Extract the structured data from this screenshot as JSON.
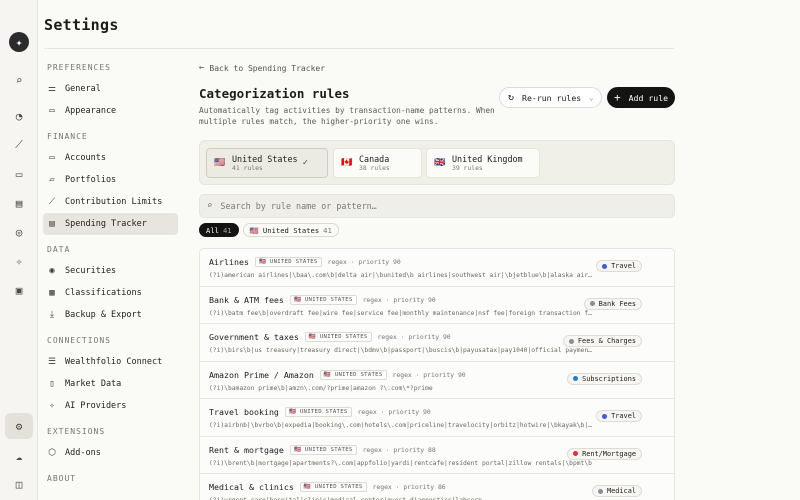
{
  "page": {
    "title": "Settings"
  },
  "rail": {
    "icons": [
      "logo-icon",
      "search-icon",
      "dashboard-icon",
      "chart-icon",
      "holdings-icon",
      "activity-icon",
      "target-icon",
      "sparkle-icon",
      "briefcase-icon",
      "settings-icon",
      "cloud-icon",
      "sidebar-toggle-icon"
    ]
  },
  "sidebar": {
    "preferences": {
      "heading": "PREFERENCES",
      "items": [
        {
          "label": "General"
        },
        {
          "label": "Appearance"
        }
      ]
    },
    "finance": {
      "heading": "FINANCE",
      "items": [
        {
          "label": "Accounts"
        },
        {
          "label": "Portfolios"
        },
        {
          "label": "Contribution Limits"
        },
        {
          "label": "Spending Tracker"
        }
      ]
    },
    "data": {
      "heading": "DATA",
      "items": [
        {
          "label": "Securities"
        },
        {
          "label": "Classifications"
        },
        {
          "label": "Backup & Export"
        }
      ]
    },
    "connections": {
      "heading": "CONNECTIONS",
      "items": [
        {
          "label": "Wealthfolio Connect"
        },
        {
          "label": "Market Data"
        },
        {
          "label": "AI Providers"
        }
      ]
    },
    "extensions": {
      "heading": "EXTENSIONS",
      "items": [
        {
          "label": "Add-ons"
        }
      ]
    },
    "about": {
      "heading": "ABOUT"
    }
  },
  "main": {
    "back_label": "Back to Spending Tracker",
    "heading": "Categorization rules",
    "description": "Automatically tag activities by transaction-name patterns. When multiple rules match, the higher-priority one wins.",
    "rerun_label": "Re-run rules",
    "add_label": "Add rule",
    "countries": [
      {
        "flag": "🇺🇸",
        "name": "United States",
        "count": "41 rules"
      },
      {
        "flag": "🇨🇦",
        "name": "Canada",
        "count": "38 rules"
      },
      {
        "flag": "🇬🇧",
        "name": "United Kingdom",
        "count": "39 rules"
      }
    ],
    "search_placeholder": "Search by rule name or pattern…",
    "filters": {
      "all_label": "All",
      "all_count": "41",
      "us_label": "🇺🇸 United States",
      "us_count": "41"
    },
    "rules": [
      {
        "name": "Airlines",
        "country": "🇺🇸 UNITED STATES",
        "meta": "regex · priority 90",
        "pattern": "(?i)american airlines|\\baa\\.com\\b|delta air|\\bunited\\b airlines|southwest air|\\bjetblue\\b|alaska airlines",
        "category": "Travel",
        "color": "#3b5bdb"
      },
      {
        "name": "Bank & ATM fees",
        "country": "🇺🇸 UNITED STATES",
        "meta": "regex · priority 90",
        "pattern": "(?i)\\batm fee\\b|overdraft fee|wire fee|service fee|monthly maintenance|nsf fee|foreign transaction fee",
        "category": "Bank Fees",
        "color": "#868e96"
      },
      {
        "name": "Government & taxes",
        "country": "🇺🇸 UNITED STATES",
        "meta": "regex · priority 90",
        "pattern": "(?i)\\birs\\b|us treasury|treasury direct|\\bdmv\\b|passport|\\buscis\\b|payusatax|pay1040|official payments",
        "category": "Fees & Charges",
        "color": "#868e96"
      },
      {
        "name": "Amazon Prime / Amazon",
        "country": "🇺🇸 UNITED STATES",
        "meta": "regex · priority 90",
        "pattern": "(?i)\\bamazon prime\\b|amzn\\.com/?prime|amazon ?\\.com\\*?prime",
        "category": "Subscriptions",
        "color": "#1c7ed6"
      },
      {
        "name": "Travel booking",
        "country": "🇺🇸 UNITED STATES",
        "meta": "regex · priority 90",
        "pattern": "(?i)airbnb|\\bvrbo\\b|expedia|booking\\.com|hotels\\.com|priceline|travelocity|orbitz|hotwire|\\bkayak\\b|trivago",
        "category": "Travel",
        "color": "#3b5bdb"
      },
      {
        "name": "Rent & mortgage",
        "country": "🇺🇸 UNITED STATES",
        "meta": "regex · priority 88",
        "pattern": "(?i)\\brent\\b|mortgage|apartments?\\.com|appfolio|yardi|rentcafe|resident portal|zillow rentals|\\bpmt\\b",
        "category": "Rent/Mortgage",
        "color": "#e03131"
      },
      {
        "name": "Medical & clinics",
        "country": "🇺🇸 UNITED STATES",
        "meta": "regex · priority 86",
        "pattern": "(?i)urgent care|hospital|clinic|medical center|quest diagnostics|labcorp",
        "category": "Medical",
        "color": "#868e96"
      }
    ]
  }
}
